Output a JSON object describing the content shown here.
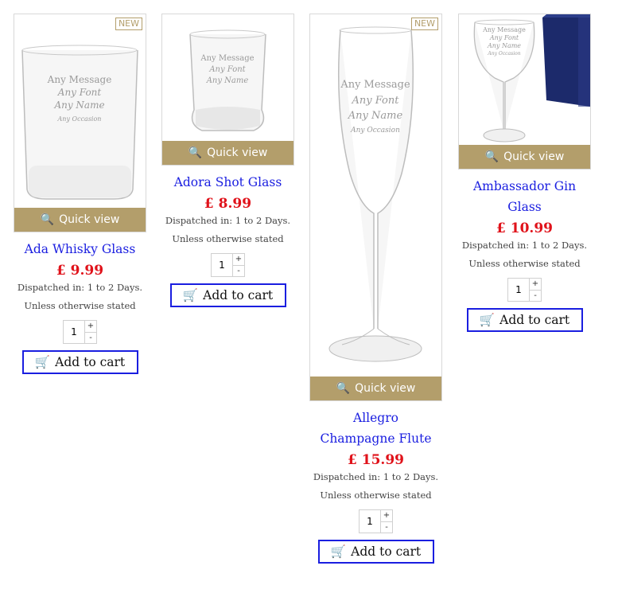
{
  "ui": {
    "quick_view": "Quick view",
    "new_badge": "NEW",
    "add_to_cart": "Add to cart"
  },
  "products": [
    {
      "name": "Ada Whisky Glass",
      "price": "£ 9.99",
      "dispatch": "Dispatched in: 1 to 2 Days.",
      "note": "Unless otherwise stated",
      "qty": "1",
      "engraving": [
        "Any Message",
        "Any Font",
        "Any Name",
        "Any Occasion"
      ]
    },
    {
      "name": "Adora Shot Glass",
      "price": "£ 8.99",
      "dispatch": "Dispatched in: 1 to 2 Days.",
      "note": "Unless otherwise stated",
      "qty": "1",
      "engraving": [
        "Any Message",
        "Any Font",
        "Any Name"
      ]
    },
    {
      "name": "Allegro Champagne Flute",
      "price": "£ 15.99",
      "dispatch": "Dispatched in: 1 to 2 Days.",
      "note": "Unless otherwise stated",
      "qty": "1",
      "engraving": [
        "Any Message",
        "Any Font",
        "Any Name",
        "Any Occasion"
      ]
    },
    {
      "name": "Ambassador Gin Glass",
      "price": "£ 10.99",
      "dispatch": "Dispatched in: 1 to 2 Days.",
      "note": "Unless otherwise stated",
      "qty": "1",
      "engraving": [
        "Any Message",
        "Any Font",
        "Any Name",
        "Any Occasion"
      ]
    }
  ],
  "colors": {
    "gold": "#b39e6b",
    "link_blue": "#1a1ee0",
    "price_red": "#e0121a"
  }
}
